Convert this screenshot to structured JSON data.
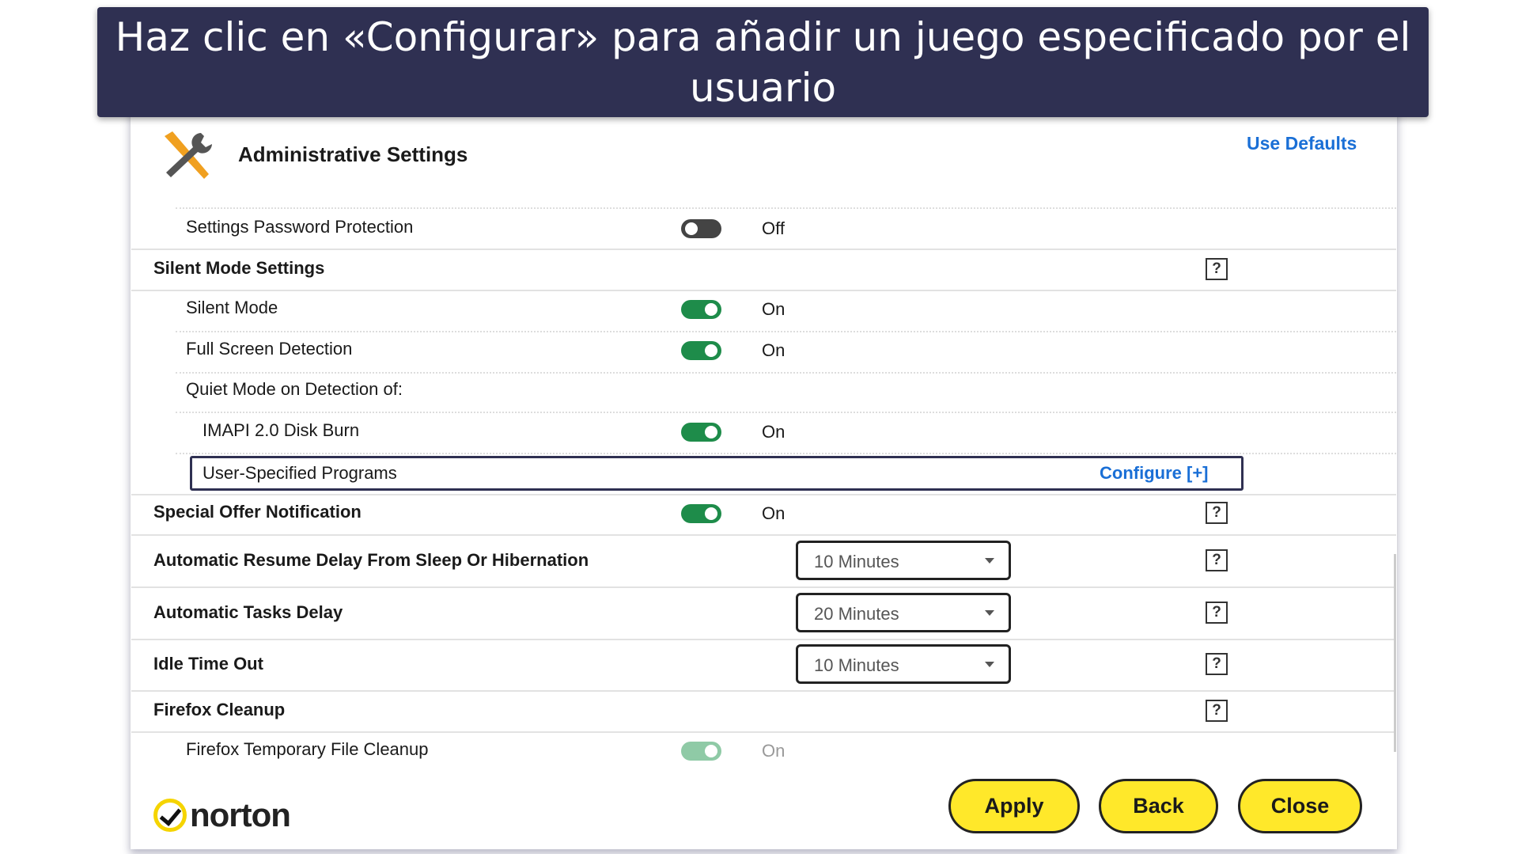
{
  "banner": {
    "text": "Haz clic en «Configurar» para añadir un juego especificado por el usuario"
  },
  "header": {
    "title": "Administrative Settings",
    "use_defaults": "Use Defaults",
    "icon": "wrench-screwdriver-icon"
  },
  "rows": {
    "password": {
      "label": "Settings Password Protection",
      "state": "Off"
    },
    "silent_heading": {
      "label": "Silent Mode Settings"
    },
    "silent_mode": {
      "label": "Silent Mode",
      "state": "On"
    },
    "full_screen": {
      "label": "Full Screen Detection",
      "state": "On"
    },
    "quiet": {
      "label": "Quiet Mode on Detection of:"
    },
    "imapi": {
      "label": "IMAPI 2.0 Disk Burn",
      "state": "On"
    },
    "user_programs": {
      "label": "User-Specified Programs",
      "action": "Configure [+]"
    },
    "special_offer": {
      "label": "Special Offer Notification",
      "state": "On"
    },
    "resume_delay": {
      "label": "Automatic Resume Delay From Sleep Or Hibernation",
      "value": "10 Minutes"
    },
    "tasks_delay": {
      "label": "Automatic Tasks Delay",
      "value": "20 Minutes"
    },
    "idle": {
      "label": "Idle Time Out",
      "value": "10 Minutes"
    },
    "firefox_heading": {
      "label": "Firefox Cleanup"
    },
    "firefox_temp": {
      "label": "Firefox Temporary File Cleanup",
      "state": "On"
    }
  },
  "help_label": "?",
  "footer": {
    "logo": "norton",
    "apply": "Apply",
    "back": "Back",
    "close": "Close"
  },
  "colors": {
    "banner": "#2f3052",
    "toggle_on": "#1e8c4a",
    "link": "#1a6fd6",
    "button": "#ffe82a"
  }
}
